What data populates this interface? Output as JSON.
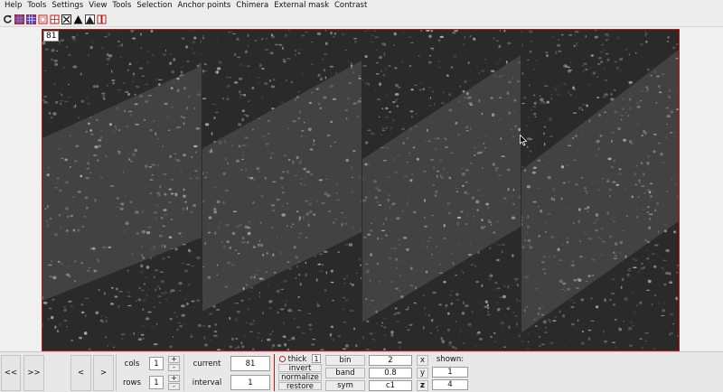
{
  "menu": {
    "items": [
      {
        "label": "Help"
      },
      {
        "label": "Tools"
      },
      {
        "label": "Settings"
      },
      {
        "label": "View"
      },
      {
        "label": "Tools"
      },
      {
        "label": "Selection"
      },
      {
        "label": "Anchor points"
      },
      {
        "label": "Chimera"
      },
      {
        "label": "External mask"
      },
      {
        "label": "Contrast"
      }
    ]
  },
  "toolbar": {
    "icons": [
      "refresh-icon",
      "grid-select-icon",
      "grid-icon",
      "rectangle-icon",
      "crosshair-icon",
      "fit-icon",
      "contrast-icon",
      "contrast-auto-icon",
      "mask-icon"
    ],
    "accent_color": "#c01818"
  },
  "viewer": {
    "frame_number": "81",
    "border_color": "#c01818",
    "panel_count": 4
  },
  "controls": {
    "first_label": "<<",
    "last_label": ">>",
    "prev_label": "<",
    "next_label": ">",
    "cols_label": "cols",
    "cols_value": "1",
    "rows_label": "rows",
    "rows_value": "1",
    "plus_label": "+",
    "minus_label": "-",
    "current_label": "current",
    "current_value": "81",
    "interval_label": "interval",
    "interval_value": "1",
    "thick_label": "thick",
    "thick_value": "1",
    "invert_label": "invert",
    "normalize_label": "normalize",
    "restore_label": "restore",
    "bin_label": "bin",
    "bin_value": "2",
    "band_label": "band",
    "band_value": "0.8",
    "sym_label": "sym",
    "sym_value": "c1",
    "x_label": "x",
    "y_label": "y",
    "z_label": "z",
    "shown_label": "shown:",
    "shown_value_1": "1",
    "shown_value_2": "4"
  }
}
